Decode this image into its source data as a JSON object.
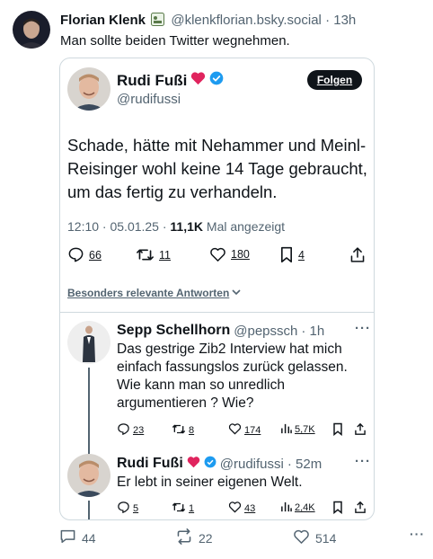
{
  "post": {
    "author_name": "Florian Klenk",
    "author_handle": "@klenkflorian.bsky.social",
    "time": "· 13h",
    "text": "Man sollte beiden Twitter wegnehmen.",
    "footer": {
      "replies": "44",
      "reposts": "22",
      "likes": "514"
    }
  },
  "tweet": {
    "author_name": "Rudi Fußi",
    "author_handle": "@rudifussi",
    "follow_label": "Folgen",
    "text": "Schade, hätte mit Nehammer und Meinl-Reisinger wohl keine 14 Tage gebraucht, um das fertig zu verhandeln.",
    "time_date": "12:10 · 05.01.25 · ",
    "views_count": "11,1K",
    "views_label": " Mal angezeigt",
    "actions": {
      "replies": "66",
      "reposts": "11",
      "likes": "180",
      "bookmarks": "4"
    },
    "best_replies_label": "Besonders relevante Antworten"
  },
  "replies": [
    {
      "name": "Sepp Schellhorn",
      "handle": "@pepssch",
      "time": "· 1h",
      "text": "Das gestrige Zib2 Interview hat mich einfach fassungslos zurück gelassen. Wie kann man so unredlich argumentieren ? Wie?",
      "actions": {
        "replies": "23",
        "reposts": "8",
        "likes": "174",
        "views": "5,7K"
      }
    },
    {
      "name": "Rudi Fußi",
      "handle": "@rudifussi",
      "time": "· 52m",
      "text": "Er lebt in seiner eigenen Welt.",
      "actions": {
        "replies": "5",
        "reposts": "1",
        "likes": "43",
        "views": "2,4K"
      }
    }
  ],
  "colors": {
    "verified": "#1d9bf0",
    "heart": "#e0245e",
    "text_muted": "#536471",
    "border": "#cfd9de"
  }
}
